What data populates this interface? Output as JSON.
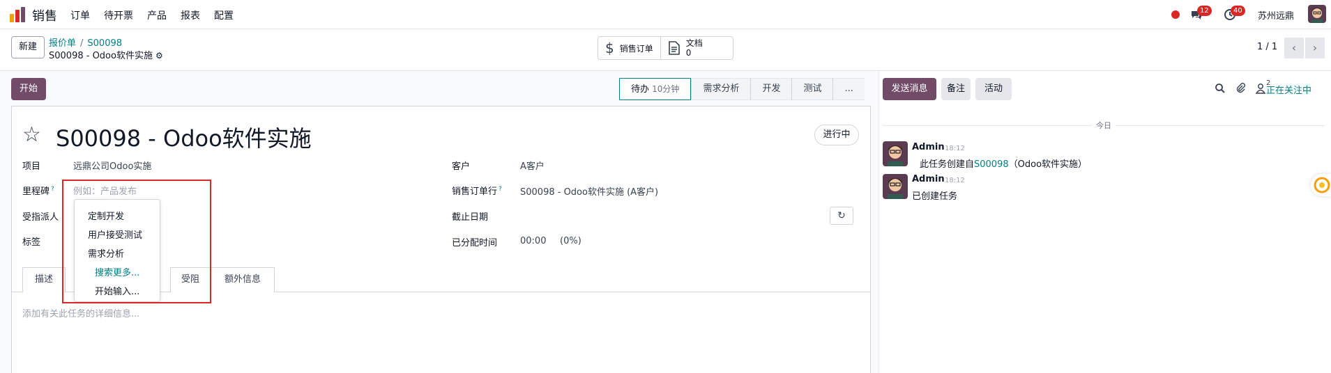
{
  "app": {
    "name": "销售",
    "logo_colors": [
      "#f59e0b",
      "#dc2626",
      "#714b67"
    ]
  },
  "nav": {
    "menu": [
      "订单",
      "待开票",
      "产品",
      "报表",
      "配置"
    ],
    "messages_badge": "12",
    "activities_badge": "40",
    "company": "苏州远鼎"
  },
  "control": {
    "new_label": "新建",
    "breadcrumb_parent": "报价单",
    "breadcrumb_sep": "/",
    "breadcrumb_current": "S00098",
    "record_sub": "S00098 - Odoo软件实施",
    "smart_sale_order": "销售订单",
    "smart_docs_label": "文档",
    "smart_docs_count": "0",
    "pager": "1 / 1"
  },
  "statusbar": {
    "start_label": "开始",
    "stages": [
      {
        "label": "待办",
        "tag": "10分钟",
        "active": true
      },
      {
        "label": "需求分析"
      },
      {
        "label": "开发"
      },
      {
        "label": "测试"
      },
      {
        "label": "..."
      }
    ]
  },
  "form": {
    "title": "S00098 - Odoo软件实施",
    "status": "进行中",
    "fields_left": [
      {
        "label": "项目",
        "value": "远鼎公司Odoo实施",
        "help": false
      },
      {
        "label": "里程碑",
        "placeholder": "例如：产品发布",
        "help": true
      },
      {
        "label": "受指派人",
        "value": ""
      },
      {
        "label": "标签",
        "value": ""
      }
    ],
    "fields_right": [
      {
        "label": "客户",
        "value": "A客户"
      },
      {
        "label": "销售订单行",
        "value": "S00098 - Odoo软件实施 (A客户)",
        "help": true
      },
      {
        "label": "截止日期",
        "value": ""
      },
      {
        "label": "已分配时间",
        "value": "00:00",
        "extra": "(0%)"
      }
    ],
    "tabs": [
      "描述",
      "受阻",
      "额外信息"
    ],
    "description_placeholder": "添加有关此任务的详细信息...",
    "dropdown": {
      "options": [
        "定制开发",
        "用户接受测试",
        "需求分析"
      ],
      "search_more": "搜索更多...",
      "start_typing": "开始输入..."
    }
  },
  "chatter": {
    "send_message": "发送消息",
    "log_note": "备注",
    "activity": "活动",
    "followers_count": "2",
    "follow_status": "正在关注中",
    "date_separator": "今日",
    "messages": [
      {
        "author": "Admin",
        "time": "18:12",
        "body_prefix": "此任务创建自",
        "body_link": "S00098",
        "body_suffix": "（Odoo软件实施）"
      },
      {
        "author": "Admin",
        "time": "18:12",
        "body": "已创建任务"
      }
    ]
  },
  "colors": {
    "brand": "#714b67",
    "link": "#017e84",
    "alert": "#dc2626"
  }
}
